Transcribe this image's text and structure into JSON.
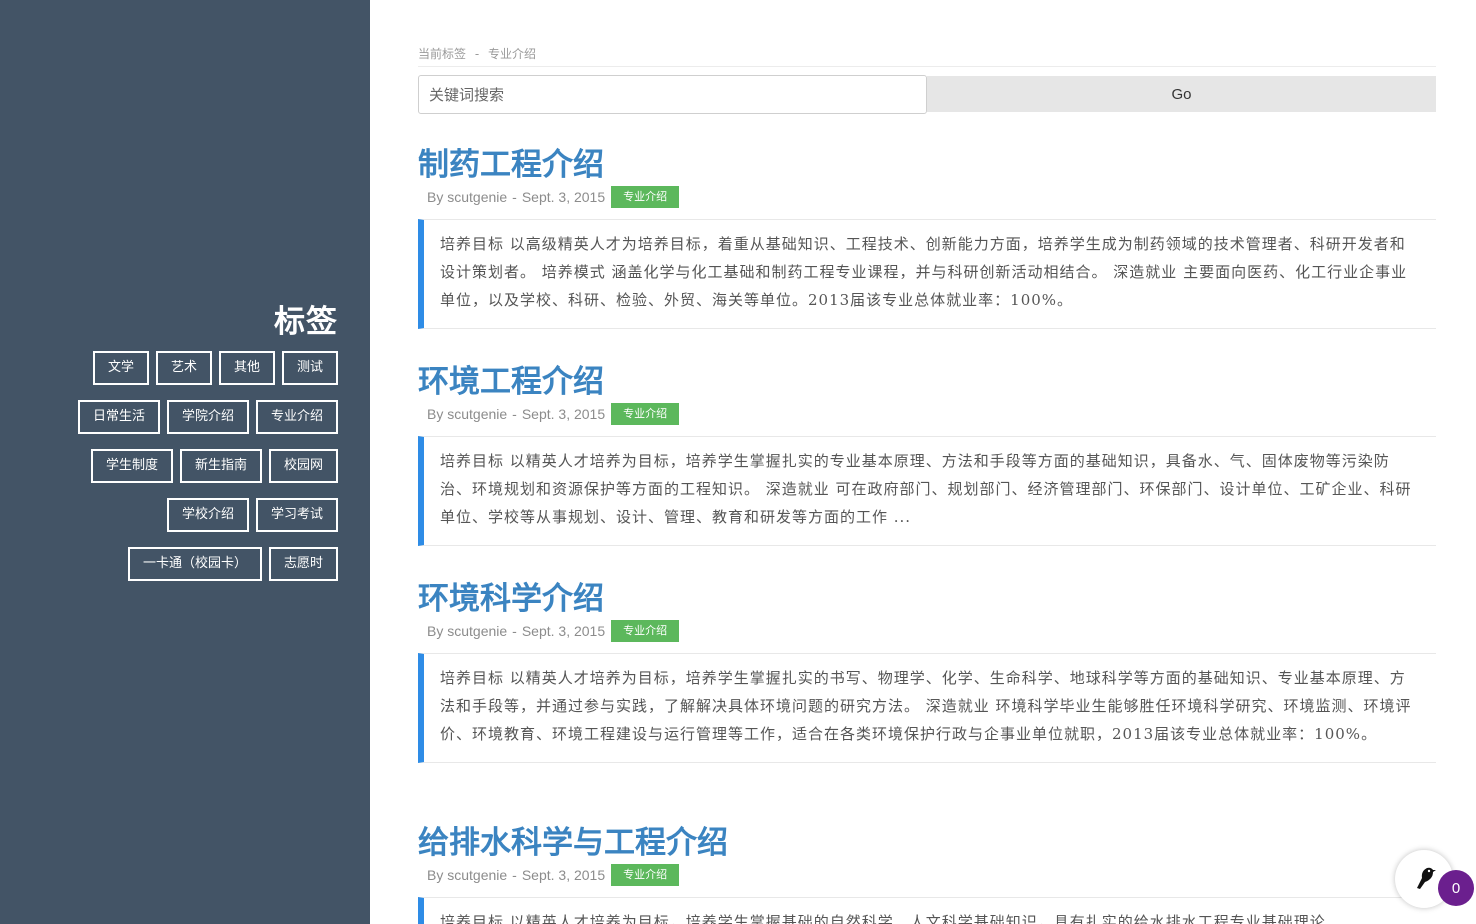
{
  "sidebar": {
    "title": "标签",
    "tag_rows": [
      [
        "文学",
        "艺术",
        "其他",
        "测试"
      ],
      [
        "日常生活",
        "学院介绍",
        "专业介绍"
      ],
      [
        "学生制度",
        "新生指南",
        "校园网"
      ],
      [
        "学校介绍",
        "学习考试"
      ],
      [
        "一卡通（校园卡）",
        "志愿时"
      ]
    ]
  },
  "breadcrumb": {
    "label": "当前标签",
    "separator": "-",
    "current": "专业介绍"
  },
  "search": {
    "placeholder": "关键词搜索",
    "button_label": "Go"
  },
  "posts": [
    {
      "title": "制药工程介绍",
      "author": "By scutgenie",
      "date": "Sept. 3, 2015",
      "tag": "专业介绍",
      "body": "培养目标 以高级精英人才为培养目标，着重从基础知识、工程技术、创新能力方面，培养学生成为制药领域的技术管理者、科研开发者和设计策划者。 培养模式 涵盖化学与化工基础和制药工程专业课程，并与科研创新活动相结合。 深造就业 主要面向医药、化工行业企事业单位，以及学校、科研、检验、外贸、海关等单位。2013届该专业总体就业率：100%。"
    },
    {
      "title": "环境工程介绍",
      "author": "By scutgenie",
      "date": "Sept. 3, 2015",
      "tag": "专业介绍",
      "body": "培养目标 以精英人才培养为目标，培养学生掌握扎实的专业基本原理、方法和手段等方面的基础知识，具备水、气、固体废物等污染防治、环境规划和资源保护等方面的工程知识。 深造就业 可在政府部门、规划部门、经济管理部门、环保部门、设计单位、工矿企业、科研单位、学校等从事规划、设计、管理、教育和研发等方面的工作 ..."
    },
    {
      "title": "环境科学介绍",
      "author": "By scutgenie",
      "date": "Sept. 3, 2015",
      "tag": "专业介绍",
      "body": "培养目标 以精英人才培养为目标，培养学生掌握扎实的书写、物理学、化学、生命科学、地球科学等方面的基础知识、专业基本原理、方法和手段等，并通过参与实践，了解解决具体环境问题的研究方法。 深造就业 环境科学毕业生能够胜任环境科学研究、环境监测、环境评价、环境教育、环境工程建设与运行管理等工作，适合在各类环境保护行政与企事业单位就职，2013届该专业总体就业率：100%。"
    },
    {
      "title": "给排水科学与工程介绍",
      "author": "By scutgenie",
      "date": "Sept. 3, 2015",
      "tag": "专业介绍",
      "body": "培养目标 以精英人才培养为目标，培养学生掌握基础的自然科学、人文科学基础知识，具有扎实的给水排水工程专业基础理论"
    }
  ],
  "widget": {
    "icon": "bird-icon",
    "badge_count": "0"
  }
}
